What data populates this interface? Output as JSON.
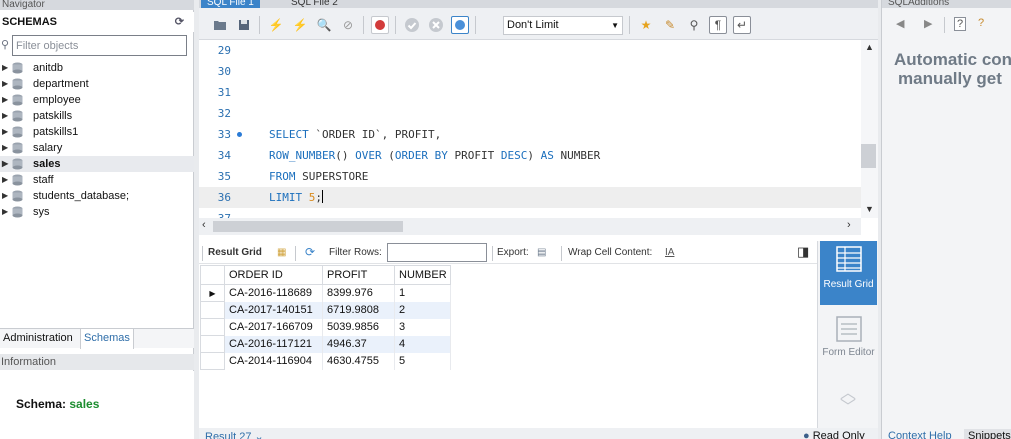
{
  "left_panel": {
    "navigator_title": "Navigator",
    "schemas_title": "SCHEMAS",
    "filter_placeholder": "Filter objects",
    "schemas": [
      {
        "name": "anitdb"
      },
      {
        "name": "department"
      },
      {
        "name": "employee"
      },
      {
        "name": "patskills"
      },
      {
        "name": "patskills1"
      },
      {
        "name": "salary"
      },
      {
        "name": "sales"
      },
      {
        "name": "staff"
      },
      {
        "name": "students_database;"
      },
      {
        "name": "sys"
      }
    ],
    "selected_schema": "sales",
    "tabs": [
      "Administration",
      "Schemas"
    ],
    "active_tab": "Schemas",
    "information_title": "Information",
    "schema_label": "Schema:",
    "schema_value": "sales"
  },
  "editor": {
    "tabs": [
      "SQL File 1",
      "SQL File 2"
    ],
    "active_tab": "SQL File 1",
    "limit_option": "Don't Limit",
    "lines": [
      {
        "n": "29",
        "code": ""
      },
      {
        "n": "30",
        "code": ""
      },
      {
        "n": "31",
        "code": ""
      },
      {
        "n": "32",
        "code": ""
      },
      {
        "n": "33",
        "code": "SELECT `ORDER ID`, PROFIT,"
      },
      {
        "n": "34",
        "code": "ROW_NUMBER() OVER (ORDER BY PROFIT DESC) AS NUMBER"
      },
      {
        "n": "35",
        "code": "FROM SUPERSTORE"
      },
      {
        "n": "36",
        "code": "LIMIT 5;"
      },
      {
        "n": "37",
        "code": ""
      }
    ]
  },
  "result_toolbar": {
    "result_grid": "Result Grid",
    "filter_rows": "Filter Rows:",
    "export": "Export:",
    "wrap_cell": "Wrap Cell Content:"
  },
  "result_grid": {
    "columns": [
      "ORDER ID",
      "PROFIT",
      "NUMBER"
    ],
    "rows": [
      [
        "CA-2016-118689",
        "8399.976",
        "1"
      ],
      [
        "CA-2017-140151",
        "6719.9808",
        "2"
      ],
      [
        "CA-2017-166709",
        "5039.9856",
        "3"
      ],
      [
        "CA-2016-117121",
        "4946.37",
        "4"
      ],
      [
        "CA-2014-116904",
        "4630.4755",
        "5"
      ]
    ]
  },
  "side_buttons": {
    "result_grid": "Result Grid",
    "form_editor": "Form Editor"
  },
  "bottom": {
    "result_tab": "Result 27",
    "read_only": "Read Only"
  },
  "right_panel": {
    "title": "SQLAdditions",
    "text_line1": "Automatic con",
    "text_line2": "manually get",
    "tab_context_help": "Context Help",
    "tab_snippets": "Snippets"
  },
  "colors": {
    "accent_blue": "#3b84c9",
    "keyword_blue": "#1b6fbd",
    "number_orange": "#d98a1c",
    "schema_green": "#1c8d2f",
    "row_highlight": "#eaf1fb"
  }
}
